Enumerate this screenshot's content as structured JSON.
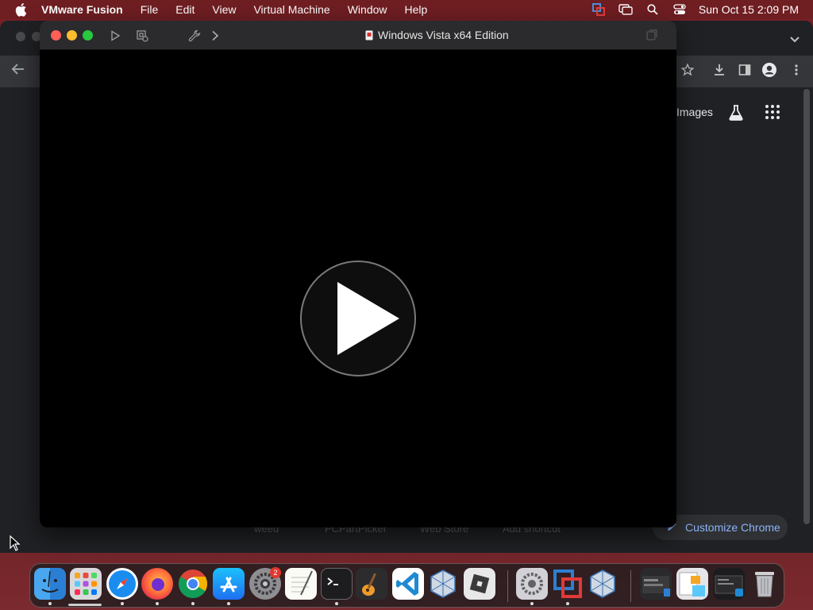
{
  "menubar": {
    "app_name": "VMware Fusion",
    "items": [
      "File",
      "Edit",
      "View",
      "Virtual Machine",
      "Window",
      "Help"
    ],
    "clock": "Sun Oct 15  2:09 PM"
  },
  "vm_window": {
    "title": "Windows Vista x64 Edition"
  },
  "chrome": {
    "images_link": "Images",
    "shortcuts": [
      "weed",
      "PCPartPicker",
      "Web Store",
      "Add shortcut"
    ],
    "customize_label": "Customize Chrome"
  },
  "dock": {
    "apps": [
      "Finder",
      "Launchpad",
      "Safari",
      "Firefox",
      "Google Chrome",
      "App Store",
      "System Settings",
      "TextEdit",
      "Terminal",
      "GarageBand",
      "Visual Studio Code",
      "VirtualBox",
      "Roblox",
      "System Settings",
      "VMware Fusion",
      "VirtualBox"
    ],
    "settings_badge": "2"
  },
  "colors": {
    "close": "#ff5f57",
    "minimize": "#febc2e",
    "zoom": "#28c840",
    "accent_link": "#8ab4f8"
  }
}
